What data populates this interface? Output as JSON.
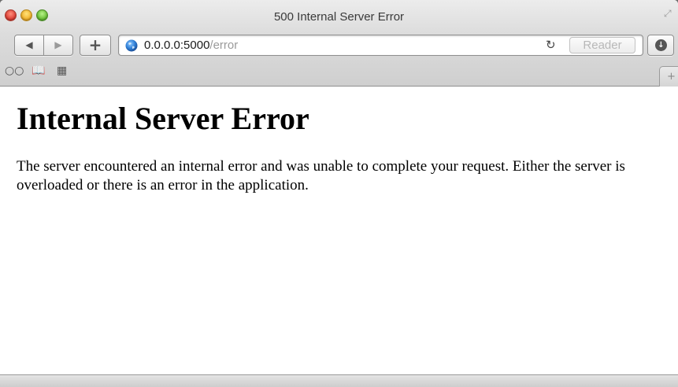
{
  "window": {
    "title": "500 Internal Server Error"
  },
  "toolbar": {
    "back_icon": "◀",
    "forward_icon": "▶",
    "new_tab_label": "+",
    "reload_icon": "↻",
    "reader_label": "Reader",
    "downloads_icon": "download-icon"
  },
  "address_bar": {
    "host": "0.0.0.0:5000",
    "path": "/error"
  },
  "bookmarks_bar": {
    "reading_list_icon": "reading-list-icon",
    "bookmarks_icon": "bookmarks-icon",
    "top_sites_icon": "top-sites-icon",
    "add_tab_label": "+"
  },
  "page": {
    "heading": "Internal Server Error",
    "message": "The server encountered an internal error and was unable to complete your request. Either the server is overloaded or there is an error in the application."
  },
  "colors": {
    "close": "#e0443a",
    "minimize": "#f3b530",
    "zoom": "#6dc23a",
    "url_path": "#9a9a9a"
  }
}
